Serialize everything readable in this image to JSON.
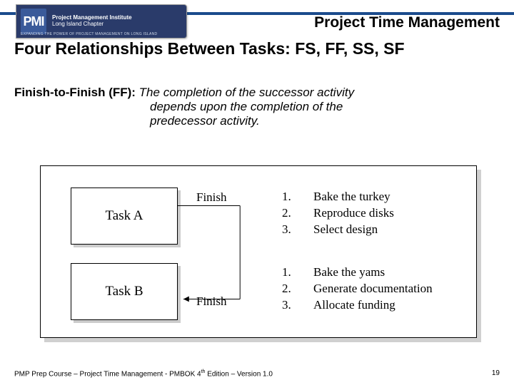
{
  "header": {
    "logo_abbrev": "PMI",
    "logo_line1": "Project Management Institute",
    "logo_line2": "Long Island Chapter",
    "logo_tagline": "EXPANDING THE POWER OF PROJECT MANAGEMENT ON LONG ISLAND",
    "title": "Project Time Management"
  },
  "slide": {
    "title": "Four Relationships Between Tasks: FS, FF, SS, SF",
    "def_label": "Finish-to-Finish (FF):",
    "def_line1": " The completion of the successor activity",
    "def_line2": "depends upon the completion of the",
    "def_line3": "predecessor activity."
  },
  "diagram": {
    "task_a": "Task A",
    "task_b": "Task B",
    "finish_top": "Finish",
    "finish_bot": "Finish",
    "list_a": {
      "n1": "1.",
      "t1": "Bake the turkey",
      "n2": "2.",
      "t2": "Reproduce disks",
      "n3": "3.",
      "t3": "Select design"
    },
    "list_b": {
      "n1": "1.",
      "t1": "Bake the yams",
      "n2": "2.",
      "t2": "Generate documentation",
      "n3": "3.",
      "t3": "Allocate funding"
    }
  },
  "footer": {
    "left": "PMP Prep Course – Project Time Management - PMBOK 4th Edition – Version 1.0",
    "page": "19"
  }
}
